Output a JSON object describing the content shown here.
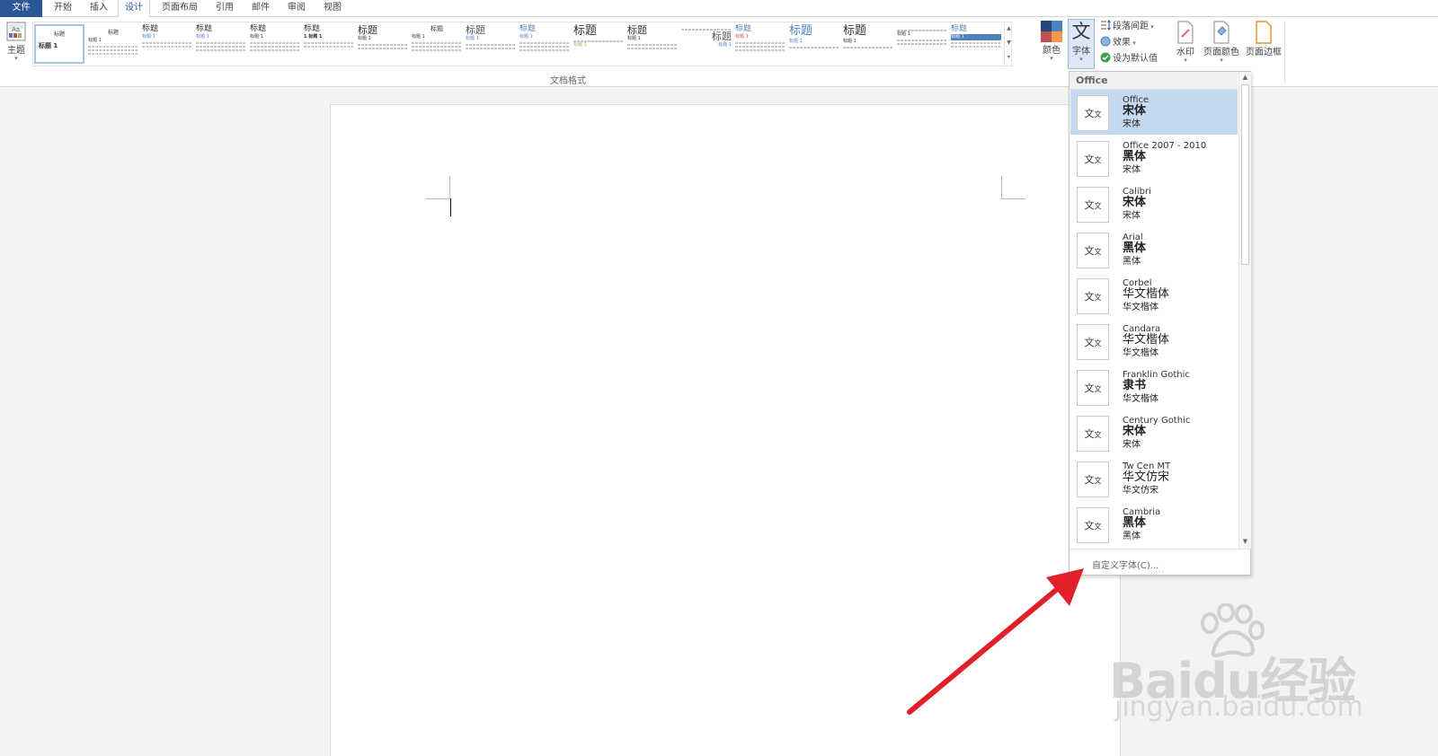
{
  "tabs": [
    {
      "label": "文件",
      "kind": "file"
    },
    {
      "label": "开始"
    },
    {
      "label": "插入"
    },
    {
      "label": "设计",
      "active": true
    },
    {
      "label": "页面布局"
    },
    {
      "label": "引用"
    },
    {
      "label": "邮件"
    },
    {
      "label": "审阅"
    },
    {
      "label": "视图"
    }
  ],
  "ribbon": {
    "theme_label": "主题",
    "gallery_group_label": "文档格式",
    "gallery": [
      {
        "title": "标题",
        "sub": "标题 1"
      },
      {
        "title": "标题",
        "sub": "标题 1"
      },
      {
        "title": "标题",
        "sub": "标题 1"
      },
      {
        "title": "标题",
        "sub": "标题 1"
      },
      {
        "title": "标题",
        "sub": "标题 1"
      },
      {
        "title": "标题",
        "sub": "1 标题 1"
      },
      {
        "title": "标题",
        "sub": "标题 1"
      },
      {
        "title": "标题",
        "sub": "标题 1"
      },
      {
        "title": "标题",
        "sub": "标题 1"
      },
      {
        "title": "标题",
        "sub": "标题 1"
      },
      {
        "title": "标题",
        "sub": "标题 1"
      },
      {
        "title": "标题",
        "sub": "标题 1"
      },
      {
        "title": "标题",
        "sub": "标题 1"
      },
      {
        "title": "标题",
        "sub": "标题 1"
      },
      {
        "title": "标题",
        "sub": "标题 1"
      },
      {
        "title": "标题",
        "sub": "标题 1"
      },
      {
        "title": "标题",
        "sub": "标题 1"
      },
      {
        "title": "标题",
        "sub": "标题 1"
      }
    ],
    "colors_label": "颜色",
    "fonts_label": "字体",
    "fonts_glyph": "文",
    "paragraph_spacing_label": "段落间距",
    "effects_label": "效果",
    "set_default_label": "设为默认值",
    "watermark_label": "水印",
    "page_color_label": "页面颜色",
    "page_borders_label": "页面边框"
  },
  "dropdown": {
    "header": "Office",
    "items": [
      {
        "name": "Office",
        "heading": "宋体",
        "body": "宋体",
        "selected": true
      },
      {
        "name": "Office 2007 - 2010",
        "heading": "黑体",
        "body": "宋体"
      },
      {
        "name": "Calibri",
        "heading": "宋体",
        "body": "宋体"
      },
      {
        "name": "Arial",
        "heading": "黑体",
        "body": "黑体"
      },
      {
        "name": "Corbel",
        "heading": "华文楷体",
        "body": "华文楷体"
      },
      {
        "name": "Candara",
        "heading": "华文楷体",
        "body": "华文楷体"
      },
      {
        "name": "Franklin Gothic",
        "heading": "隶书",
        "body": "华文楷体"
      },
      {
        "name": "Century Gothic",
        "heading": "宋体",
        "body": "宋体"
      },
      {
        "name": "Tw Cen MT",
        "heading": "华文仿宋",
        "body": "华文仿宋"
      },
      {
        "name": "Cambria",
        "heading": "黑体",
        "body": "黑体"
      }
    ],
    "preview_glyph": "文",
    "preview_glyph_small": "文",
    "custom_fonts_label": "自定义字体(C)..."
  },
  "watermark": {
    "brand": "Baidu经验",
    "site": "jingyan.baidu.com"
  },
  "colors": {
    "file_tab": "#2b579a",
    "accent": "#2b579a",
    "selection": "#c5d9f1",
    "arrow": "#e0202a"
  }
}
